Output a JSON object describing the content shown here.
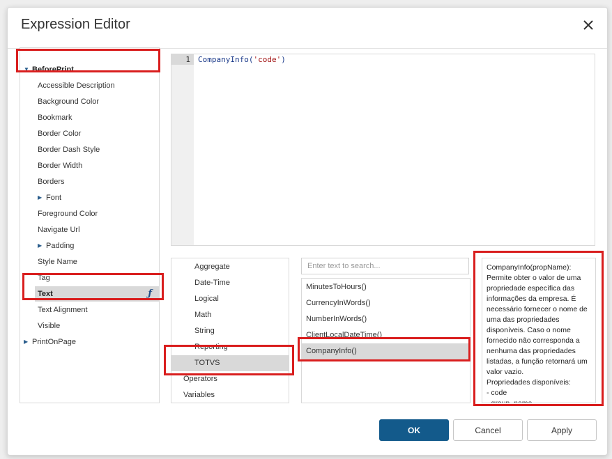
{
  "dialog": {
    "title": "Expression Editor"
  },
  "tree": {
    "items": [
      {
        "label": "BeforePrint",
        "level": 0,
        "caret": "down",
        "bold": true
      },
      {
        "label": "Accessible Description",
        "level": 1
      },
      {
        "label": "Background Color",
        "level": 1
      },
      {
        "label": "Bookmark",
        "level": 1
      },
      {
        "label": "Border Color",
        "level": 1
      },
      {
        "label": "Border Dash Style",
        "level": 1
      },
      {
        "label": "Border Width",
        "level": 1
      },
      {
        "label": "Borders",
        "level": 1
      },
      {
        "label": "Font",
        "level": 1,
        "caret": "right"
      },
      {
        "label": "Foreground Color",
        "level": 1
      },
      {
        "label": "Navigate Url",
        "level": 1
      },
      {
        "label": "Padding",
        "level": 1,
        "caret": "right"
      },
      {
        "label": "Style Name",
        "level": 1
      },
      {
        "label": "Tag",
        "level": 1
      },
      {
        "label": "Text",
        "level": 1,
        "bold": true,
        "selected": true,
        "icon": "function-icon"
      },
      {
        "label": "Text Alignment",
        "level": 1
      },
      {
        "label": "Visible",
        "level": 1
      },
      {
        "label": "PrintOnPage",
        "level": 0,
        "caret": "right"
      }
    ]
  },
  "editor": {
    "line_number": "1",
    "code_prefix": "CompanyInfo(",
    "code_string": "'code'",
    "code_suffix": ")"
  },
  "categories": {
    "items": [
      {
        "label": "Aggregate",
        "level": 1
      },
      {
        "label": "Date-Time",
        "level": 1
      },
      {
        "label": "Logical",
        "level": 1
      },
      {
        "label": "Math",
        "level": 1
      },
      {
        "label": "String",
        "level": 1
      },
      {
        "label": "Reporting",
        "level": 1
      },
      {
        "label": "TOTVS",
        "level": 1,
        "selected": true
      },
      {
        "label": "Operators",
        "level": 0
      },
      {
        "label": "Variables",
        "level": 0
      }
    ]
  },
  "search": {
    "placeholder": "Enter text to search...",
    "value": ""
  },
  "functions": {
    "items": [
      {
        "label": "MinutesToHours()"
      },
      {
        "label": "CurrencyInWords()"
      },
      {
        "label": "NumberInWords()"
      },
      {
        "label": "ClientLocalDateTime()"
      },
      {
        "label": "CompanyInfo()",
        "selected": true
      }
    ]
  },
  "description": {
    "text": "CompanyInfo(propName): Permite obter o valor de uma propriedade específica das informações da empresa. É necessário fornecer o nome de uma das propriedades disponíveis. Caso o nome fornecido não corresponda a nenhuma das propriedades listadas, a função retornará um valor vazio.\nPropriedades disponíveis:\n- code\n- group_name"
  },
  "buttons": {
    "ok": "OK",
    "cancel": "Cancel",
    "apply": "Apply"
  },
  "colors": {
    "primary_button": "#135a8b",
    "highlight": "#d91e1e",
    "selection": "#d9d9d9"
  }
}
